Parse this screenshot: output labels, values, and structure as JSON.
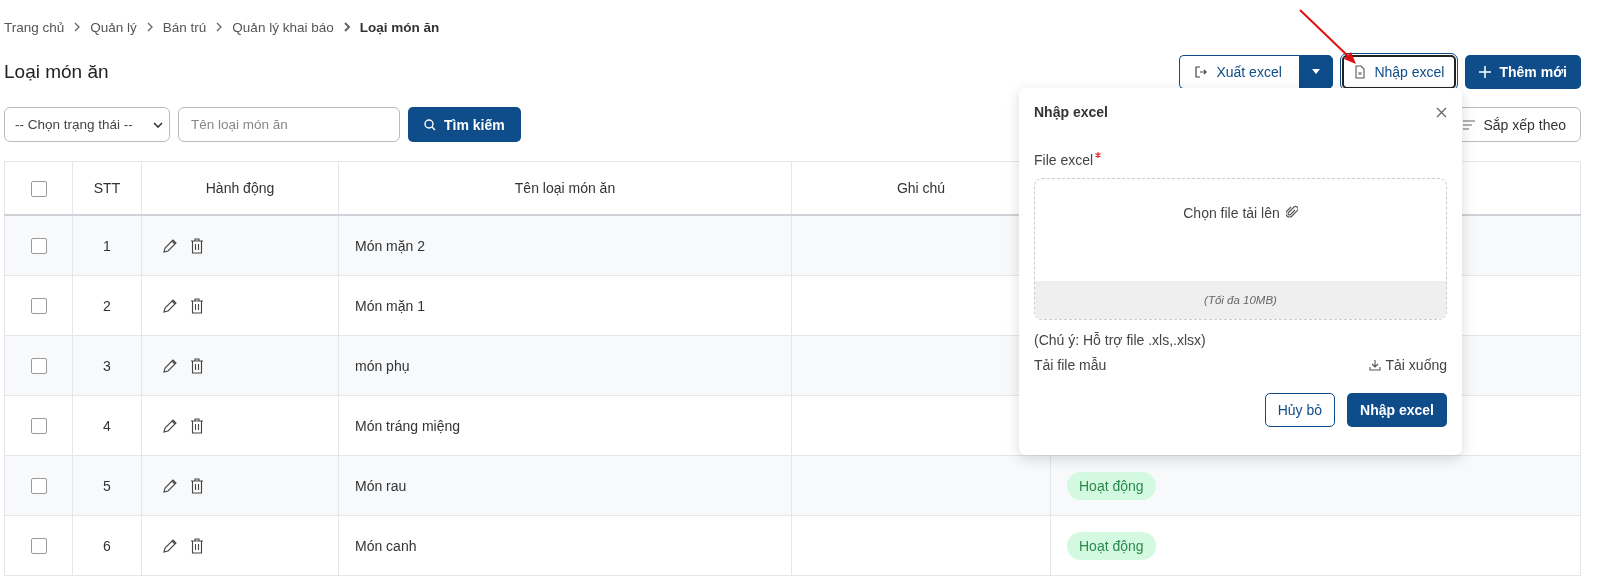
{
  "breadcrumb": [
    {
      "label": "Trang chủ",
      "current": false
    },
    {
      "label": "Quản lý",
      "current": false
    },
    {
      "label": "Bán trú",
      "current": false
    },
    {
      "label": "Quản lý khai báo",
      "current": false
    },
    {
      "label": "Loại món ăn",
      "current": true
    }
  ],
  "page_title": "Loại món ăn",
  "actions": {
    "export": "Xuất excel",
    "import": "Nhập excel",
    "add": "Thêm mới"
  },
  "filters": {
    "status_select": "-- Chọn trạng thái --",
    "name_placeholder": "Tên loại món ăn",
    "search": "Tìm kiếm",
    "sort": "Sắp xếp theo"
  },
  "table": {
    "all_checked": false,
    "columns": [
      "STT",
      "Hành động",
      "Tên loại món ăn",
      "Ghi chú"
    ],
    "rows": [
      {
        "stt": "1",
        "name": "Món mặn 2",
        "checked": false
      },
      {
        "stt": "2",
        "name": "Món mặn 1",
        "checked": false
      },
      {
        "stt": "3",
        "name": "món phụ",
        "checked": false
      },
      {
        "stt": "4",
        "name": "Món tráng miệng",
        "checked": false
      },
      {
        "stt": "5",
        "name": "Món rau",
        "checked": false,
        "status": "Hoạt động"
      },
      {
        "stt": "6",
        "name": "Món canh",
        "checked": false,
        "status": "Hoạt động"
      }
    ]
  },
  "import_dialog": {
    "title": "Nhập excel",
    "field_label": "File excel",
    "required": true,
    "upload_text": "Chọn file tải lên",
    "limit": "(Tối đa 10MB)",
    "note": "(Chú ý: Hỗ trợ file .xls,.xlsx)",
    "template_label": "Tải file mẫu",
    "download": "Tải xuống",
    "cancel": "Hủy bỏ",
    "submit": "Nhập excel"
  }
}
